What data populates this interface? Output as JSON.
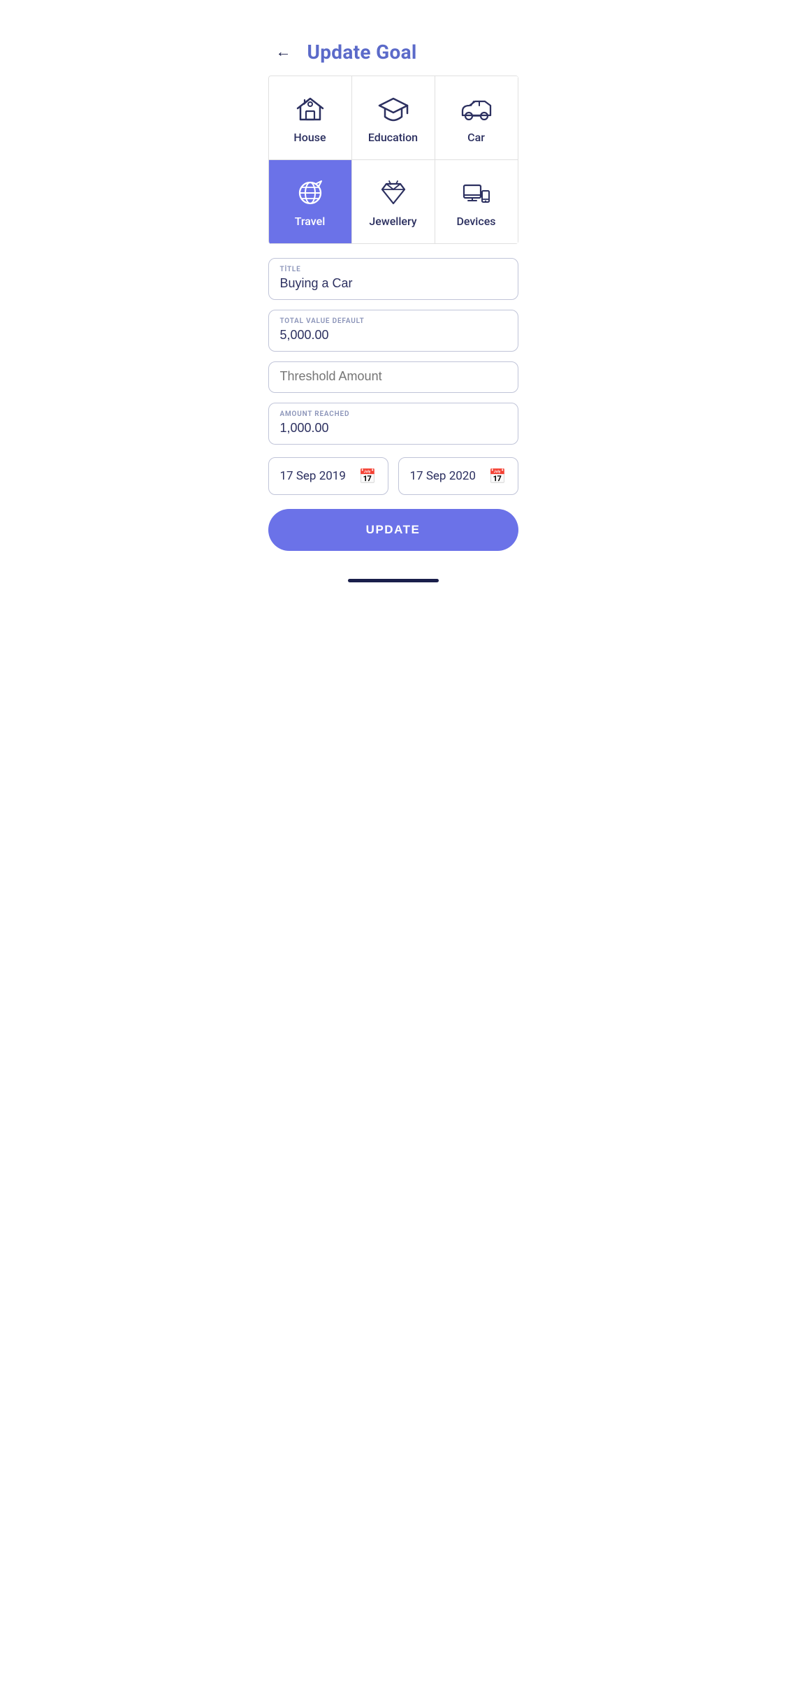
{
  "header": {
    "title": "Update Goal",
    "back_label": "←"
  },
  "categories": [
    {
      "id": "house",
      "label": "House",
      "active": false,
      "icon": "house"
    },
    {
      "id": "education",
      "label": "Education",
      "active": false,
      "icon": "education"
    },
    {
      "id": "car",
      "label": "Car",
      "active": false,
      "icon": "car"
    },
    {
      "id": "travel",
      "label": "Travel",
      "active": true,
      "icon": "travel"
    },
    {
      "id": "jewellery",
      "label": "Jewellery",
      "active": false,
      "icon": "jewellery"
    },
    {
      "id": "devices",
      "label": "Devices",
      "active": false,
      "icon": "devices"
    }
  ],
  "form": {
    "title_label": "TİTLE",
    "title_value": "Buying a Car",
    "total_label": "TOTAL VALUE DEFAULT",
    "total_value": "5,000.00",
    "threshold_placeholder": "Threshold Amount",
    "amount_label": "AMOUNT REACHED",
    "amount_value": "1,000.00",
    "start_date": "17 Sep 2019",
    "end_date": "17 Sep 2020"
  },
  "buttons": {
    "update_label": "UPDATE"
  }
}
